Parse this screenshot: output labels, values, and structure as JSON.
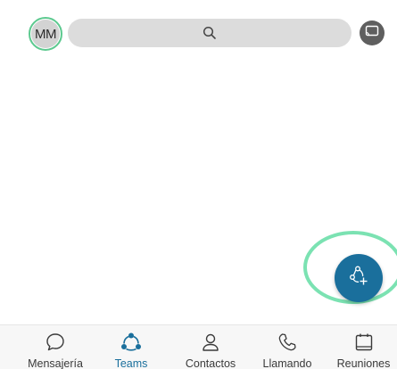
{
  "header": {
    "avatar_initials": "MM",
    "avatar_ring_color": "#5cc98f",
    "search_icon": "search-icon",
    "cast_icon": "cast-icon"
  },
  "fab": {
    "icon": "new-team-icon",
    "color": "#1a6f9c",
    "highlight_color": "#7be2b2"
  },
  "bottom_nav": {
    "active_color": "#1a6f9c",
    "items": [
      {
        "label": "Mensajería",
        "icon": "chat-bubble-icon",
        "active": false
      },
      {
        "label": "Teams",
        "icon": "teams-icon",
        "active": true
      },
      {
        "label": "Contactos",
        "icon": "person-icon",
        "active": false
      },
      {
        "label": "Llamando",
        "icon": "phone-icon",
        "active": false
      },
      {
        "label": "Reuniones",
        "icon": "calendar-icon",
        "active": false
      }
    ]
  }
}
